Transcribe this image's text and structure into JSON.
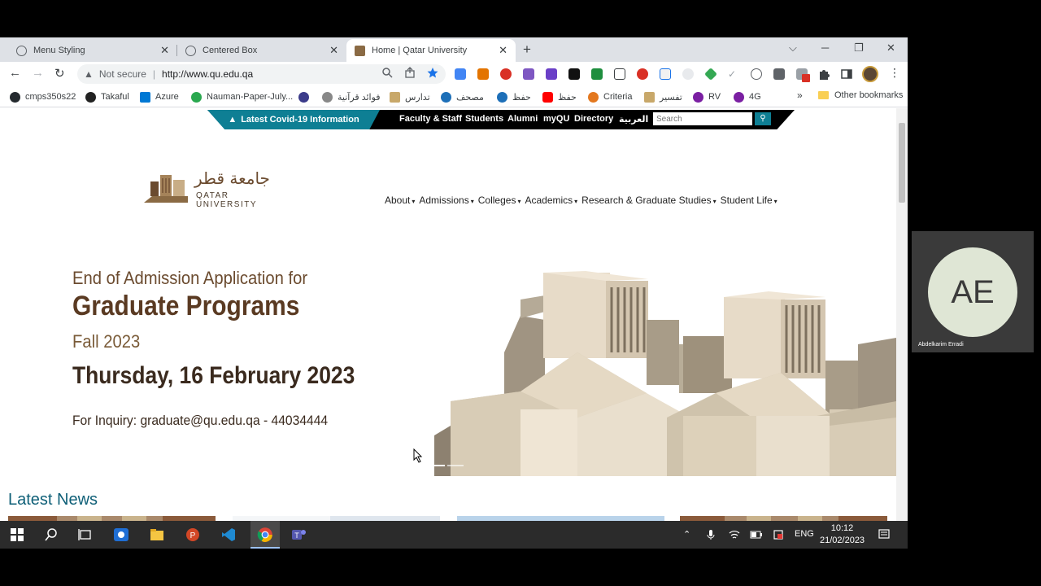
{
  "browser": {
    "tabs": [
      {
        "label": "Menu Styling"
      },
      {
        "label": "Centered Box"
      },
      {
        "label": "Home | Qatar University"
      }
    ],
    "tab_close": "✕",
    "new_tab": "+",
    "window": {
      "list": "⌵",
      "minimize": "─",
      "restore": "❐",
      "close": "✕"
    },
    "nav": {
      "back": "←",
      "forward": "→",
      "reload": "↻"
    },
    "omnibox": {
      "warning": "▲",
      "security": "Not secure",
      "url": "http://www.qu.edu.qa"
    },
    "kebab": "⋮",
    "bookmarks": [
      {
        "label": "cmps350s22",
        "color": "#24292e"
      },
      {
        "label": "Takaful",
        "color": "#222222"
      },
      {
        "label": "Azure",
        "color": "#0078d4"
      },
      {
        "label": "Nauman-Paper-July...",
        "color": "#2aa84f"
      },
      {
        "label": "",
        "color": "#3b3b8a"
      },
      {
        "label": "فوائد قرآنية",
        "color": "#666666"
      },
      {
        "label": "تدارس",
        "color": "#c8a86a"
      },
      {
        "label": "مصحف",
        "color": "#1d6fb8"
      },
      {
        "label": "حفظ",
        "color": "#1d6fb8"
      },
      {
        "label": "حفظ",
        "color": "#ff0000"
      },
      {
        "label": "Criteria",
        "color": "#e3781f"
      },
      {
        "label": "تفسير",
        "color": "#c8a86a"
      },
      {
        "label": "RV",
        "color": "#7a1fa2"
      },
      {
        "label": "4G",
        "color": "#7a1fa2"
      }
    ],
    "bookmarks_more": "»",
    "other_bookmarks": "Other bookmarks"
  },
  "site": {
    "covid_link": "Latest Covid-19 Information",
    "covid_icon": "▲",
    "top_links": [
      "Faculty & Staff",
      "Students",
      "Alumni",
      "myQU",
      "Directory",
      "العربية"
    ],
    "search_placeholder": "Search",
    "search_icon": "⚲",
    "logo": {
      "arabic": "جامعة قطر",
      "english": "QATAR UNIVERSITY"
    },
    "main_nav": [
      {
        "label": "About"
      },
      {
        "label": "Admissions"
      },
      {
        "label": "Colleges"
      },
      {
        "label": "Academics"
      },
      {
        "label": "Research & Graduate Studies"
      },
      {
        "label": "Student Life"
      }
    ],
    "nav_caret": "▾",
    "hero": {
      "line1": "End of Admission Application for",
      "line2": "Graduate Programs",
      "line3": "Fall 2023",
      "line4": "Thursday, 16 February 2023",
      "line5": "For Inquiry: graduate@qu.edu.qa - 44034444"
    },
    "latest_news_title": "Latest News"
  },
  "taskbar": {
    "start_icon": "windows-logo",
    "tray": {
      "chevron": "⌃",
      "language": "ENG"
    },
    "clock": {
      "time": "10:12",
      "date": "21/02/2023"
    }
  },
  "meeting": {
    "initials": "AE",
    "participant_name": "Abdelkarim Erradi"
  }
}
